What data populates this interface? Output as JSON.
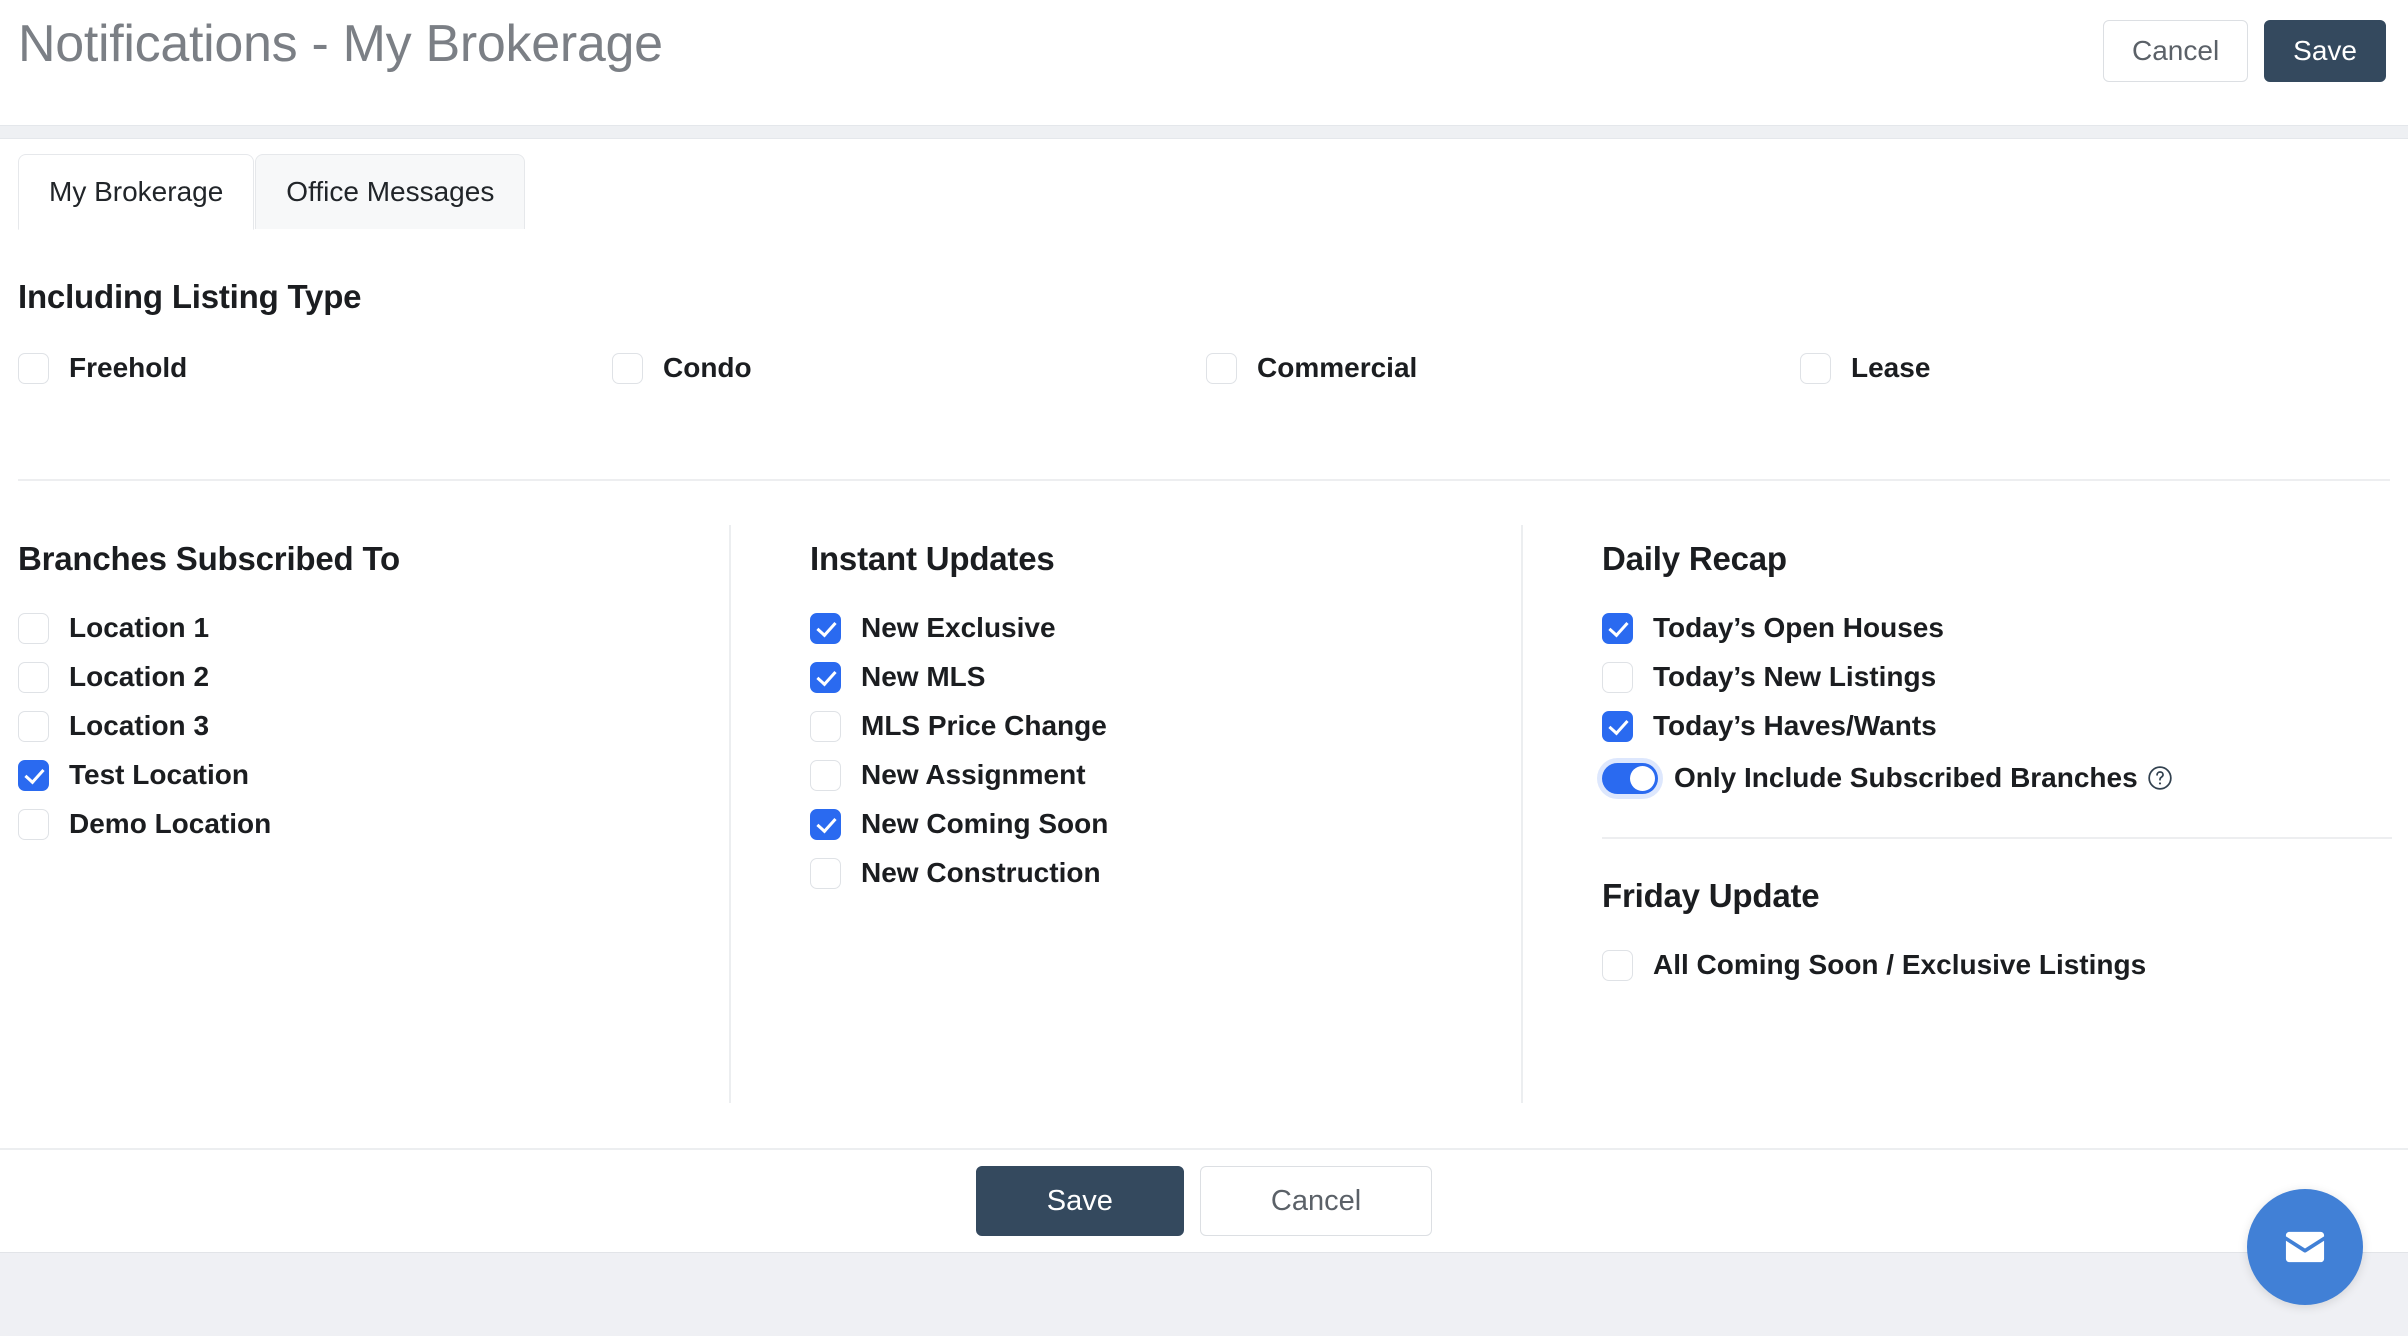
{
  "header": {
    "title": "Notifications - My Brokerage",
    "cancel_label": "Cancel",
    "save_label": "Save"
  },
  "tabs": [
    {
      "label": "My Brokerage",
      "active": true
    },
    {
      "label": "Office Messages",
      "active": false
    }
  ],
  "listing_type": {
    "heading": "Including Listing Type",
    "options": [
      {
        "label": "Freehold",
        "checked": false
      },
      {
        "label": "Condo",
        "checked": false
      },
      {
        "label": "Commercial",
        "checked": false
      },
      {
        "label": "Lease",
        "checked": false
      }
    ]
  },
  "branches": {
    "heading": "Branches Subscribed To",
    "options": [
      {
        "label": "Location 1",
        "checked": false
      },
      {
        "label": "Location 2",
        "checked": false
      },
      {
        "label": "Location 3",
        "checked": false
      },
      {
        "label": "Test Location",
        "checked": true
      },
      {
        "label": "Demo Location",
        "checked": false
      }
    ]
  },
  "instant_updates": {
    "heading": "Instant Updates",
    "options": [
      {
        "label": "New Exclusive",
        "checked": true
      },
      {
        "label": "New MLS",
        "checked": true
      },
      {
        "label": "MLS Price Change",
        "checked": false
      },
      {
        "label": "New Assignment",
        "checked": false
      },
      {
        "label": "New Coming Soon",
        "checked": true
      },
      {
        "label": "New Construction",
        "checked": false
      }
    ]
  },
  "daily_recap": {
    "heading": "Daily Recap",
    "options": [
      {
        "label": "Today’s Open Houses",
        "checked": true
      },
      {
        "label": "Today’s New Listings",
        "checked": false
      },
      {
        "label": "Today’s Haves/Wants",
        "checked": true
      }
    ],
    "toggle": {
      "label": "Only Include Subscribed Branches",
      "on": true,
      "help_icon": "question-circle-icon"
    }
  },
  "friday_update": {
    "heading": "Friday Update",
    "options": [
      {
        "label": "All Coming Soon / Exclusive Listings",
        "checked": false
      }
    ]
  },
  "footer": {
    "save_label": "Save",
    "cancel_label": "Cancel"
  },
  "fab": {
    "icon": "mail-envelope-icon"
  },
  "colors": {
    "primary_dark": "#34495e",
    "accent_blue": "#2a6af0",
    "fab_blue": "#4180d6",
    "title_gray": "#7b7f85",
    "text_dark": "#1b1d20",
    "divider": "#edeef0",
    "strip_gray": "#eff0f4"
  }
}
